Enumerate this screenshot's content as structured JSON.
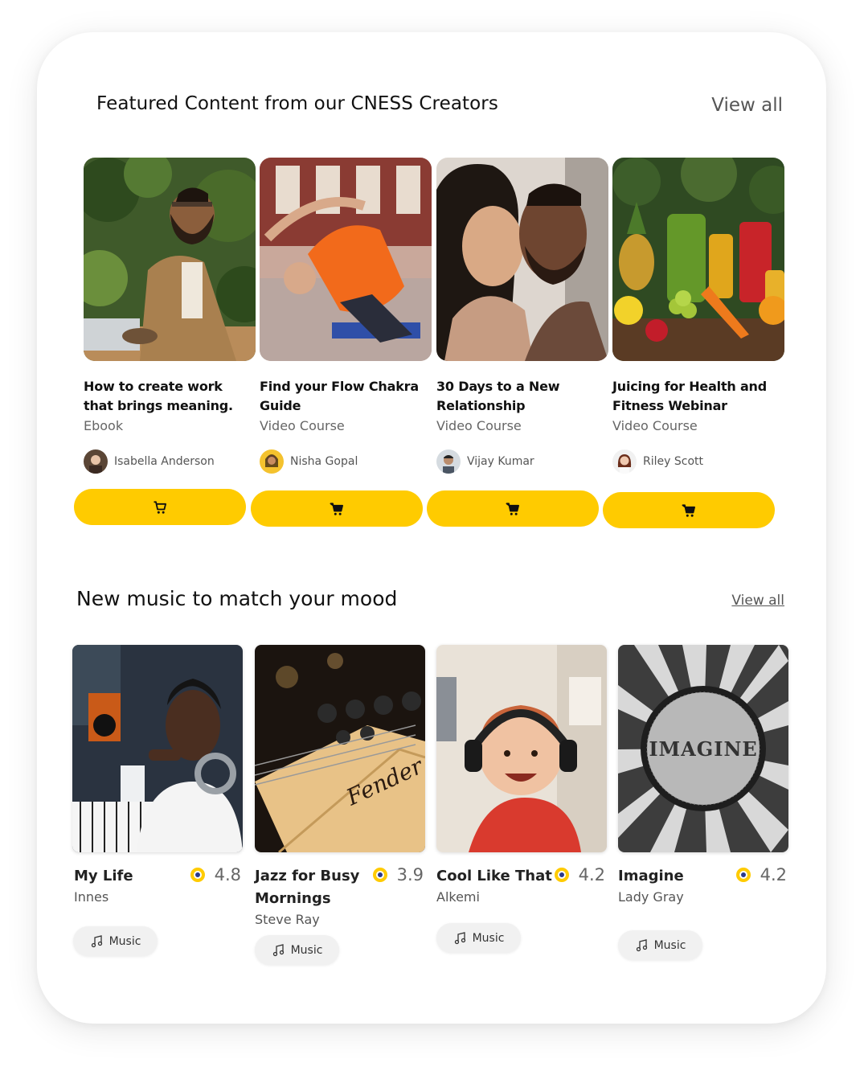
{
  "featured": {
    "title": "Featured Content from our CNESS Creators",
    "view_all": "View all",
    "items": [
      {
        "title": "How to create work that brings meaning.",
        "type": "Ebook",
        "author": "Isabella Anderson"
      },
      {
        "title": "Find your Flow Chakra Guide",
        "type": "Video Course",
        "author": "Nisha Gopal"
      },
      {
        "title": "30 Days to a New Relationship",
        "type": "Video Course",
        "author": "Vijay Kumar"
      },
      {
        "title": "Juicing for Health and Fitness Webinar",
        "type": "Video Course",
        "author": "Riley Scott"
      }
    ]
  },
  "music": {
    "title": "New music to match your mood",
    "view_all": "View all",
    "items": [
      {
        "title": "My Life",
        "artist": "Innes",
        "rating": "4.8",
        "tag": "Music"
      },
      {
        "title": "Jazz for Busy Mornings",
        "artist": "Steve Ray",
        "rating": "3.9",
        "tag": "Music"
      },
      {
        "title": "Cool Like That",
        "artist": "Alkemi",
        "rating": "4.2",
        "tag": "Music"
      },
      {
        "title": "Imagine",
        "artist": "Lady Gray",
        "rating": "4.2",
        "tag": "Music",
        "image_text": "IMAGINE"
      }
    ]
  },
  "colors": {
    "accent": "#ffcb00",
    "coin_center": "#2a3a8c"
  },
  "icons": {
    "cart": "cart-icon",
    "music": "music-note-icon",
    "coin": "coin-icon"
  }
}
